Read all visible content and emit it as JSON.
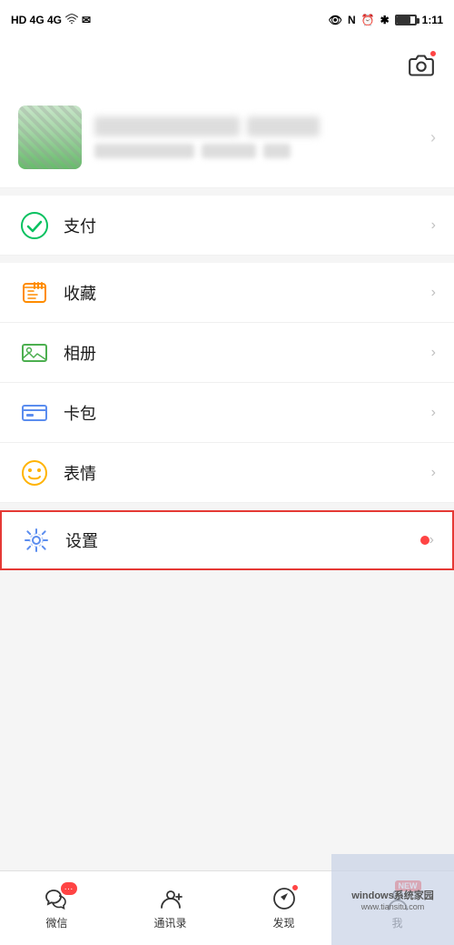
{
  "statusBar": {
    "left": "HD 4G 4G",
    "time": "1:11"
  },
  "camera": {
    "label": "camera"
  },
  "profile": {
    "nameBlur": true,
    "arrowLabel": ">"
  },
  "menu": {
    "items": [
      {
        "id": "pay",
        "label": "支付",
        "iconType": "pay",
        "hasDot": false
      },
      {
        "id": "collect",
        "label": "收藏",
        "iconType": "collect",
        "hasDot": false
      },
      {
        "id": "album",
        "label": "相册",
        "iconType": "album",
        "hasDot": false
      },
      {
        "id": "card",
        "label": "卡包",
        "iconType": "card",
        "hasDot": false
      },
      {
        "id": "emoji",
        "label": "表情",
        "iconType": "emoji",
        "hasDot": false
      },
      {
        "id": "settings",
        "label": "设置",
        "iconType": "settings",
        "hasDot": true,
        "highlighted": true
      }
    ]
  },
  "bottomNav": {
    "items": [
      {
        "id": "wechat",
        "label": "微信",
        "iconType": "chat",
        "badgeText": "···"
      },
      {
        "id": "contacts",
        "label": "通讯录",
        "iconType": "contacts",
        "badgeText": ""
      },
      {
        "id": "discover",
        "label": "发现",
        "iconType": "compass",
        "hasDot": true
      },
      {
        "id": "me",
        "label": "我",
        "iconType": "person",
        "newBadge": "NEW"
      }
    ]
  },
  "watermark": {
    "line1": "windows系统家园",
    "line2": "www.tiansitu.com"
  }
}
